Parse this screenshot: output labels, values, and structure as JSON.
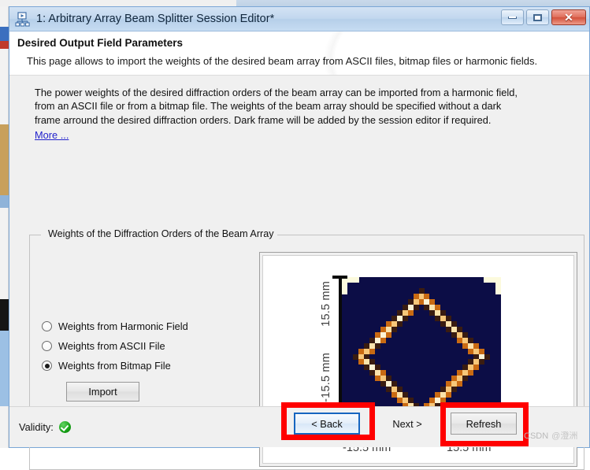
{
  "window": {
    "title": "1: Arbitrary Array Beam Splitter Session Editor*",
    "icon": "network-nodes-icon",
    "buttons": {
      "minimize": "minimize-icon",
      "maximize": "maximize-icon",
      "close": "✕"
    }
  },
  "header": {
    "title": "Desired Output Field Parameters",
    "subtitle": "This page allows to import the weights of the desired beam array from ASCII files, bitmap files or harmonic fields."
  },
  "intro": {
    "line1": "The power weights of the desired diffraction orders of the beam array can be imported from a harmonic field,",
    "line2": "from an ASCII file or from a bitmap file. The weights of the beam array should be specified without a dark",
    "line3": "frame arround the desired diffraction orders. Dark frame will be added by the session editor if required.",
    "more_link": "More ..."
  },
  "groupbox": {
    "label": "Weights of the Diffraction Orders of the Beam Array"
  },
  "options": [
    {
      "label": "Weights from Harmonic Field",
      "selected": false
    },
    {
      "label": "Weights from ASCII File",
      "selected": false
    },
    {
      "label": "Weights from Bitmap File",
      "selected": true
    }
  ],
  "import_button": {
    "label": "Import"
  },
  "chart_data": {
    "type": "heatmap",
    "title": "",
    "xlabel": "",
    "ylabel": "",
    "x_tick_labels": [
      "-15.5 mm",
      "15.5 mm"
    ],
    "y_tick_labels": [
      "15.5 mm",
      "-15.5 mm"
    ],
    "xlim": [
      -15.5,
      15.5
    ],
    "ylim": [
      -15.5,
      15.5
    ],
    "grid": false,
    "legend": "none",
    "background_color": "#0c0d46",
    "corner_marker_color": "#fcfadd",
    "colormap": [
      "#0c0d46",
      "#3a1c10",
      "#c96a12",
      "#f0a040",
      "#f7c77a",
      "#fbe3ac",
      "#fcf3d6"
    ],
    "description": "Pixelated diamond (rhombus) outline of bright diffraction-order weights on a dark background; four cream L-shaped corner markers at the image corners.",
    "grid_size": [
      29,
      29
    ],
    "diamond": {
      "center": [
        14,
        14
      ],
      "radius": 11,
      "line_thickness_cells": 2
    }
  },
  "footer": {
    "validity_label": "Validity:",
    "validity_state": "valid",
    "back_label": "< Back",
    "next_label": "Next >",
    "refresh_label": "Refresh"
  },
  "annotations": {
    "color": "#ff0000",
    "targets": [
      "back-button",
      "refresh-button"
    ]
  },
  "watermark": {
    "source": "CSDN",
    "author": "@澄洲"
  }
}
